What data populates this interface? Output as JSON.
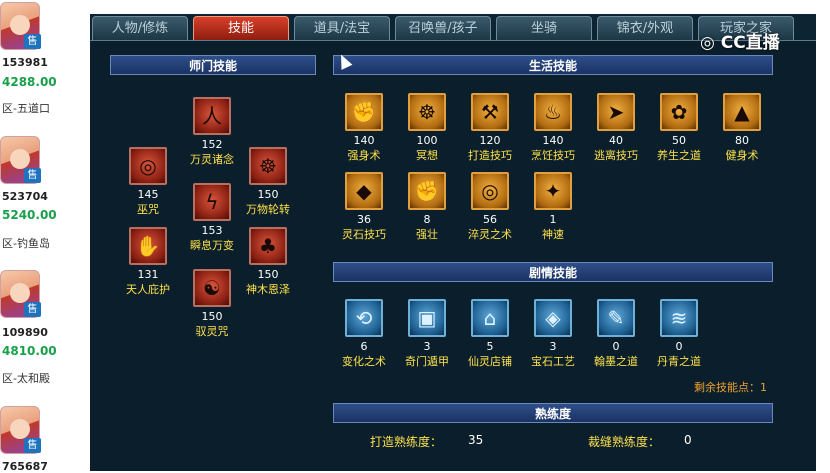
{
  "listings": [
    {
      "id": "153981",
      "price": "4288.00",
      "server": "区-五道口",
      "badge": "售"
    },
    {
      "id": "523704",
      "price": "5240.00",
      "server": "区-钓鱼岛",
      "badge": "售"
    },
    {
      "id": "109890",
      "price": "4810.00",
      "server": "区-太和殿",
      "badge": "售"
    },
    {
      "id": "765687",
      "price": "",
      "server": "",
      "badge": "售"
    }
  ],
  "tabs": [
    {
      "label": "人物/修炼"
    },
    {
      "label": "技能",
      "active": true
    },
    {
      "label": "道具/法宝"
    },
    {
      "label": "召唤兽/孩子"
    },
    {
      "label": "坐骑"
    },
    {
      "label": "锦衣/外观"
    },
    {
      "label": "玩家之家"
    }
  ],
  "watermark": "CC直播",
  "sections": {
    "school": "师门技能",
    "life": "生活技能",
    "plot": "剧情技能",
    "proficiency": "熟练度"
  },
  "school_skills": [
    {
      "level": "152",
      "name": "万灵诸念",
      "icon": "kneeling-figure-icon"
    },
    {
      "level": "145",
      "name": "巫咒",
      "icon": "spiral-icon"
    },
    {
      "level": "150",
      "name": "万物轮转",
      "icon": "wheel-icon"
    },
    {
      "level": "153",
      "name": "瞬息万变",
      "icon": "lightning-icon"
    },
    {
      "level": "131",
      "name": "天人庇护",
      "icon": "hands-icon"
    },
    {
      "level": "150",
      "name": "神木恩泽",
      "icon": "tree-icon"
    },
    {
      "level": "150",
      "name": "驭灵咒",
      "icon": "spirit-icon"
    }
  ],
  "life_skills": [
    {
      "level": "140",
      "name": "强身术",
      "icon": "muscle-icon"
    },
    {
      "level": "100",
      "name": "冥想",
      "icon": "meditation-icon"
    },
    {
      "level": "120",
      "name": "打造技巧",
      "icon": "hammer-icon"
    },
    {
      "level": "140",
      "name": "烹饪技巧",
      "icon": "cooking-icon"
    },
    {
      "level": "40",
      "name": "逃离技巧",
      "icon": "run-icon"
    },
    {
      "level": "50",
      "name": "养生之道",
      "icon": "herb-icon"
    },
    {
      "level": "80",
      "name": "健身术",
      "icon": "fitness-icon"
    },
    {
      "level": "36",
      "name": "灵石技巧",
      "icon": "gem-icon"
    },
    {
      "level": "8",
      "name": "强壮",
      "icon": "strength-icon"
    },
    {
      "level": "56",
      "name": "淬灵之术",
      "icon": "tornado-icon"
    },
    {
      "level": "1",
      "name": "神速",
      "icon": "speed-icon"
    }
  ],
  "plot_skills": [
    {
      "level": "6",
      "name": "变化之术",
      "icon": "transform-icon"
    },
    {
      "level": "3",
      "name": "奇门遁甲",
      "icon": "maze-icon"
    },
    {
      "level": "5",
      "name": "仙灵店铺",
      "icon": "shop-icon"
    },
    {
      "level": "3",
      "name": "宝石工艺",
      "icon": "jewel-icon"
    },
    {
      "level": "0",
      "name": "翰墨之道",
      "icon": "brush-icon"
    },
    {
      "level": "0",
      "name": "丹青之道",
      "icon": "scroll-icon"
    }
  ],
  "remaining_points": "剩余技能点：1",
  "proficiency": {
    "forge_label": "打造熟练度：",
    "forge_value": "35",
    "tailor_label": "裁缝熟练度：",
    "tailor_value": "0"
  }
}
